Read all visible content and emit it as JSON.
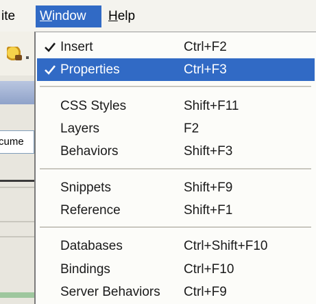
{
  "menubar": {
    "site_label": "ite",
    "window_label": "Window",
    "window_mnemonic": "W",
    "window_rest": "indow",
    "help_label": "Help",
    "help_mnemonic": "H",
    "help_rest": "elp"
  },
  "background": {
    "document_field_text": "cume"
  },
  "window_menu": {
    "items": [
      {
        "label": "Insert",
        "shortcut": "Ctrl+F2",
        "checked": true,
        "highlighted": false
      },
      {
        "label": "Properties",
        "shortcut": "Ctrl+F3",
        "checked": true,
        "highlighted": true
      },
      {
        "label": "CSS Styles",
        "shortcut": "Shift+F11",
        "checked": false,
        "highlighted": false
      },
      {
        "label": "Layers",
        "shortcut": "F2",
        "checked": false,
        "highlighted": false
      },
      {
        "label": "Behaviors",
        "shortcut": "Shift+F3",
        "checked": false,
        "highlighted": false
      },
      {
        "label": "Snippets",
        "shortcut": "Shift+F9",
        "checked": false,
        "highlighted": false
      },
      {
        "label": "Reference",
        "shortcut": "Shift+F1",
        "checked": false,
        "highlighted": false
      },
      {
        "label": "Databases",
        "shortcut": "Ctrl+Shift+F10",
        "checked": false,
        "highlighted": false
      },
      {
        "label": "Bindings",
        "shortcut": "Ctrl+F10",
        "checked": false,
        "highlighted": false
      },
      {
        "label": "Server Behaviors",
        "shortcut": "Ctrl+F9",
        "checked": false,
        "highlighted": false
      }
    ]
  },
  "colors": {
    "highlight": "#316ac5",
    "menu_background": "#fcfcf9",
    "text": "#1a1a1a"
  },
  "icons": {
    "check": "checkmark-icon",
    "toolbar_tool": "insert-tool-icon"
  }
}
